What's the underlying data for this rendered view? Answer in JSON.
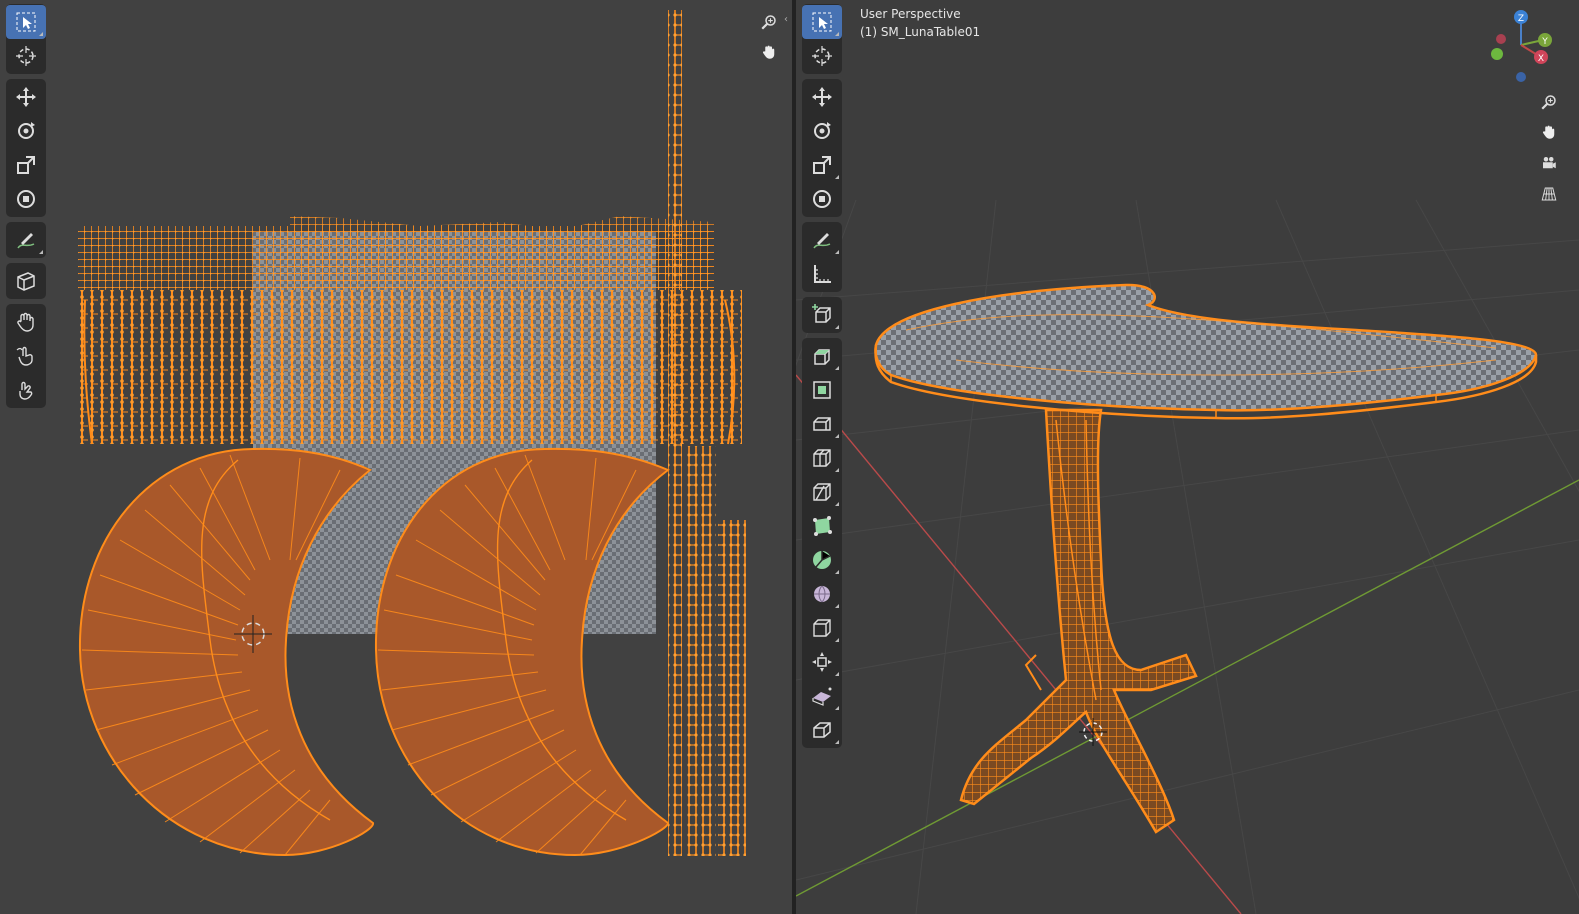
{
  "viewport": {
    "view_name": "User Perspective",
    "object_label": "(1) SM_LunaTable01",
    "gizmo_axes": {
      "z": "Z",
      "y": "Y",
      "x": "X"
    }
  },
  "uv_editor": {
    "tools": [
      "select-box",
      "cursor",
      "move",
      "rotate",
      "scale",
      "transform",
      "annotate",
      "rip-region",
      "grab",
      "relax",
      "pinch"
    ]
  },
  "viewport_tools": [
    "select-box",
    "cursor",
    "move",
    "rotate",
    "scale",
    "transform",
    "annotate",
    "measure",
    "add-cube",
    "extrude-region",
    "inset-faces",
    "bevel",
    "loop-cut",
    "knife",
    "poly-build",
    "spin",
    "smooth",
    "edge-slide",
    "shrink-fatten",
    "shear",
    "rip-region"
  ],
  "colors": {
    "mesh_orange": "#ff8c1a",
    "face_fill": "#b25a26",
    "active_tool": "#4772b3",
    "x_axis": "#c04848",
    "y_axis": "#7aa63a"
  }
}
